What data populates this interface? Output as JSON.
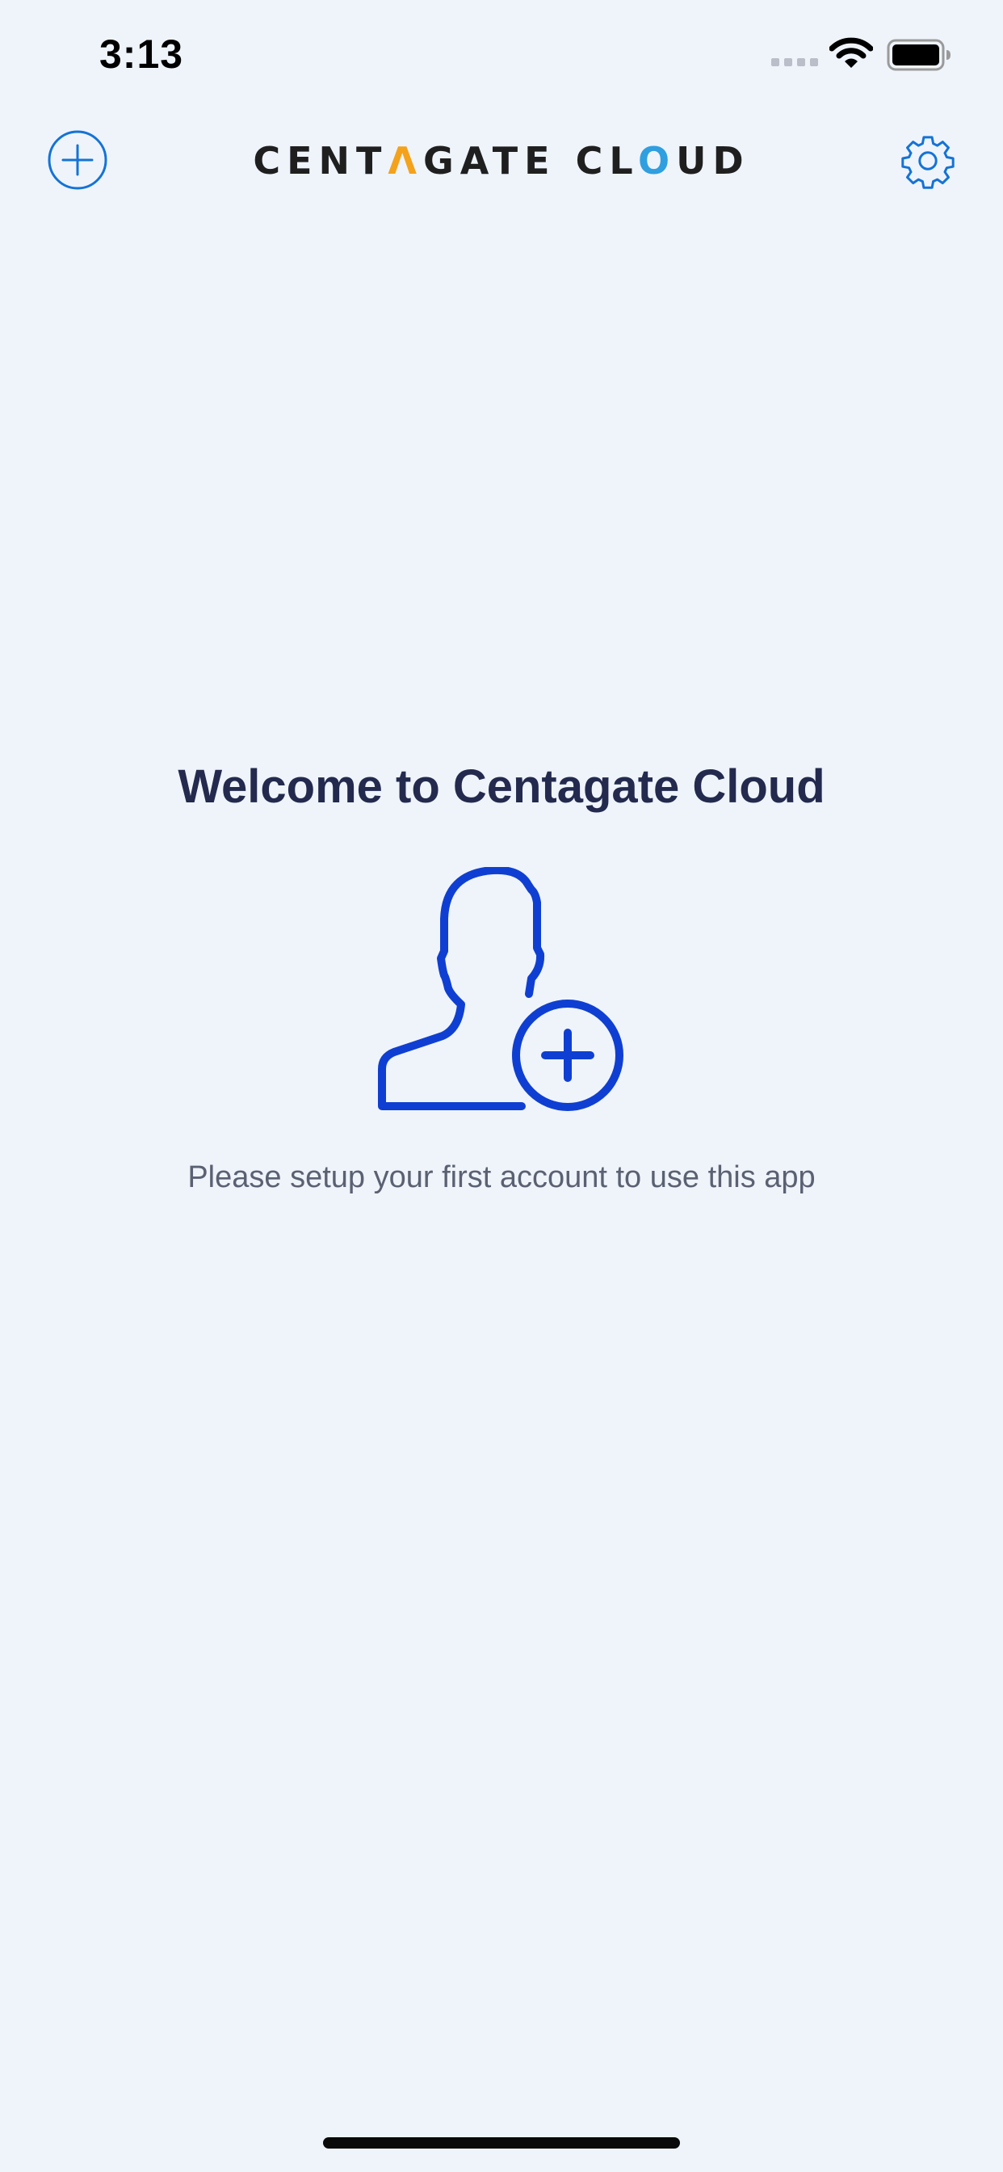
{
  "status_bar": {
    "time": "3:13",
    "signal_icon": "cellular-signal-icon",
    "wifi_icon": "wifi-icon",
    "battery_icon": "battery-icon"
  },
  "nav": {
    "add_icon": "plus-circle-icon",
    "settings_icon": "gear-icon",
    "logo": {
      "part1": "CENT",
      "part2": "Λ",
      "part3": "GATE CL",
      "part4": "O",
      "part5": "UD"
    }
  },
  "welcome": {
    "title": "Welcome to Centagate Cloud",
    "illustration_icon": "add-user-icon",
    "subtitle": "Please setup your first account to use this app"
  },
  "colors": {
    "background": "#eff4fb",
    "accent": "#1473d6",
    "illustration": "#0f3fd2",
    "logo_dark": "#1f1f1f",
    "logo_orange": "#f4a21b",
    "logo_blue": "#2f9fe0"
  }
}
